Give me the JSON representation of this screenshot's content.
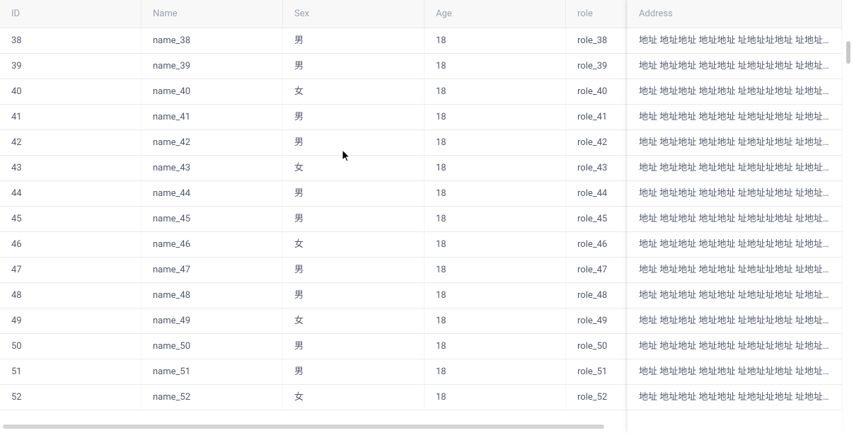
{
  "columns": {
    "id": "ID",
    "name": "Name",
    "sex": "Sex",
    "age": "Age",
    "role": "role",
    "address": "Address"
  },
  "address_text": "地址 地址地址 地址地址 址地址址地址 址地址 址…",
  "rows": [
    {
      "id": "38",
      "name": "name_38",
      "sex": "男",
      "age": "18",
      "role": "role_38"
    },
    {
      "id": "39",
      "name": "name_39",
      "sex": "男",
      "age": "18",
      "role": "role_39"
    },
    {
      "id": "40",
      "name": "name_40",
      "sex": "女",
      "age": "18",
      "role": "role_40"
    },
    {
      "id": "41",
      "name": "name_41",
      "sex": "男",
      "age": "18",
      "role": "role_41"
    },
    {
      "id": "42",
      "name": "name_42",
      "sex": "男",
      "age": "18",
      "role": "role_42"
    },
    {
      "id": "43",
      "name": "name_43",
      "sex": "女",
      "age": "18",
      "role": "role_43"
    },
    {
      "id": "44",
      "name": "name_44",
      "sex": "男",
      "age": "18",
      "role": "role_44"
    },
    {
      "id": "45",
      "name": "name_45",
      "sex": "男",
      "age": "18",
      "role": "role_45"
    },
    {
      "id": "46",
      "name": "name_46",
      "sex": "女",
      "age": "18",
      "role": "role_46"
    },
    {
      "id": "47",
      "name": "name_47",
      "sex": "男",
      "age": "18",
      "role": "role_47"
    },
    {
      "id": "48",
      "name": "name_48",
      "sex": "男",
      "age": "18",
      "role": "role_48"
    },
    {
      "id": "49",
      "name": "name_49",
      "sex": "女",
      "age": "18",
      "role": "role_49"
    },
    {
      "id": "50",
      "name": "name_50",
      "sex": "男",
      "age": "18",
      "role": "role_50"
    },
    {
      "id": "51",
      "name": "name_51",
      "sex": "男",
      "age": "18",
      "role": "role_51"
    },
    {
      "id": "52",
      "name": "name_52",
      "sex": "女",
      "age": "18",
      "role": "role_52"
    }
  ]
}
